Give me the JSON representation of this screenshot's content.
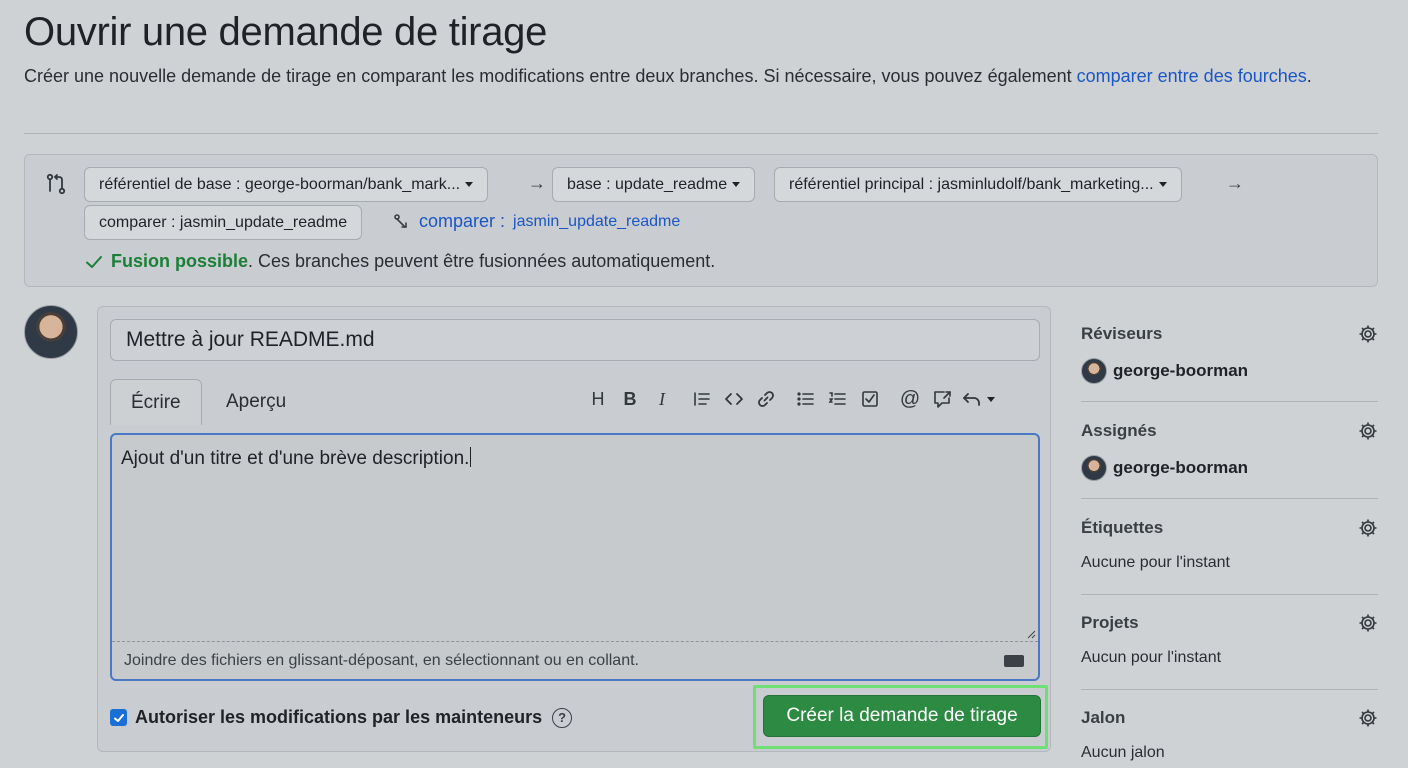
{
  "page": {
    "title": "Ouvrir une demande de tirage",
    "subtitle": "Créer une nouvelle demande de tirage en comparant les modifications entre deux branches. Si nécessaire, vous pouvez également ",
    "subtitle_link": "comparer entre des fourches",
    "subtitle_end": "."
  },
  "compare": {
    "base_repo": "référentiel de base : george-boorman/bank_mark...",
    "base_branch": "base : update_readme",
    "head_repo": "référentiel principal : jasminludolf/bank_marketing...",
    "compare_branch": "comparer : jasmin_update_readme",
    "compare_link_label": "comparer :",
    "compare_link_value": "jasmin_update_readme",
    "merge_ok": "Fusion possible",
    "merge_text": ". Ces branches peuvent être fusionnées automatiquement."
  },
  "form": {
    "title_value": "Mettre à jour README.md",
    "tab_write": "Écrire",
    "tab_preview": "Aperçu",
    "body_text": "Ajout d'un titre et d'une brève description.",
    "attach_text": "Joindre des fichiers en glissant-déposant, en sélectionnant ou en collant.",
    "allow_edits": "Autoriser les modifications par les mainteneurs",
    "allow_edits_checked": true,
    "create_button": "Créer la demande de tirage"
  },
  "toolbar": {
    "icons": [
      "heading-icon",
      "bold-icon",
      "italic-icon",
      "quote-icon",
      "code-icon",
      "link-icon",
      "bullet-list-icon",
      "numbered-list-icon",
      "task-list-icon",
      "mention-icon",
      "reference-icon",
      "undo-icon"
    ],
    "heading_glyph": "H",
    "bold_glyph": "B",
    "italic_glyph": "I",
    "mention_glyph": "@"
  },
  "sidebar": {
    "reviewers": {
      "label": "Réviseurs",
      "value": "george-boorman"
    },
    "assignees": {
      "label": "Assignés",
      "value": "george-boorman"
    },
    "labels": {
      "label": "Étiquettes",
      "value": "Aucune pour l'instant"
    },
    "projects": {
      "label": "Projets",
      "value": "Aucun pour l'instant"
    },
    "milestone": {
      "label": "Jalon",
      "value": "Aucun jalon"
    }
  },
  "colors": {
    "accent_link": "#1a56c4",
    "success": "#1a7f37",
    "primary_button": "#2d8a43",
    "highlight": "#6fe074"
  }
}
